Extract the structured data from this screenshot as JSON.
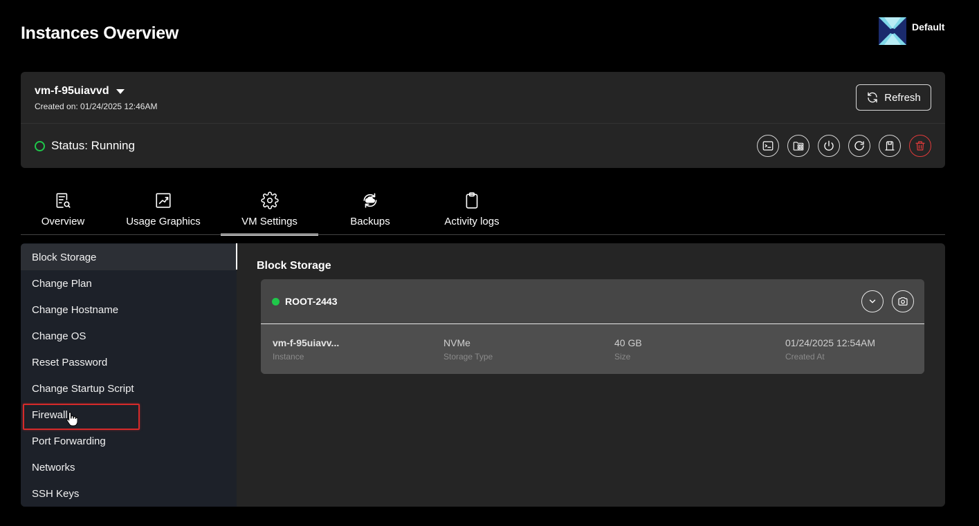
{
  "header": {
    "title": "Instances Overview",
    "org_name": "Default"
  },
  "instance": {
    "name": "vm-f-95uiavvd",
    "created_on": "Created on: 01/24/2025 12:46AM",
    "refresh_label": "Refresh",
    "status": "Status: Running",
    "status_color": "#1fc84a",
    "actions": [
      "console-icon",
      "apps-folder-icon",
      "power-icon",
      "restart-icon",
      "save-icon",
      "delete-icon"
    ]
  },
  "tabs": [
    {
      "label": "Overview",
      "icon": "document-search-icon"
    },
    {
      "label": "Usage Graphics",
      "icon": "chart-line-icon"
    },
    {
      "label": "VM Settings",
      "icon": "gear-icon",
      "active": true
    },
    {
      "label": "Backups",
      "icon": "cloud-backup-icon"
    },
    {
      "label": "Activity logs",
      "icon": "clipboard-icon"
    }
  ],
  "settings_menu": [
    {
      "label": "Block Storage",
      "active": true
    },
    {
      "label": "Change Plan"
    },
    {
      "label": "Change Hostname"
    },
    {
      "label": "Change OS"
    },
    {
      "label": "Reset Password"
    },
    {
      "label": "Change Startup Script"
    },
    {
      "label": "Firewall",
      "highlighted": true
    },
    {
      "label": "Port Forwarding"
    },
    {
      "label": "Networks"
    },
    {
      "label": "SSH Keys"
    }
  ],
  "block_storage": {
    "title": "Block Storage",
    "volume_name": "ROOT-2443",
    "columns": [
      {
        "value": "vm-f-95uiavv...",
        "label": "Instance"
      },
      {
        "value": "NVMe",
        "label": "Storage Type"
      },
      {
        "value": "40 GB",
        "label": "Size"
      },
      {
        "value": "01/24/2025 12:54AM",
        "label": "Created At"
      }
    ]
  },
  "colors": {
    "background": "#000000",
    "card": "#252525",
    "accent_green": "#1fc84a",
    "danger": "#e03a3a",
    "highlight": "#d62a2a"
  }
}
